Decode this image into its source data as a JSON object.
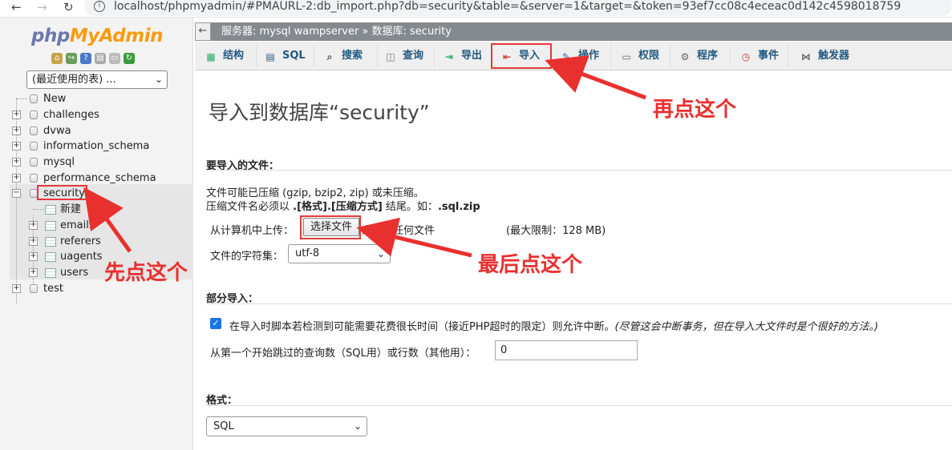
{
  "browser": {
    "url": "localhost/phpmyadmin/#PMAURL-2:db_import.php?db=security&table=&server=1&target=&token=93ef7cc08c4eceac0d142c4598018759"
  },
  "sidebar": {
    "logo_php": "php",
    "logo_myadmin": "MyAdmin",
    "recent_select": "(最近使用的表) ...",
    "tree": [
      {
        "label": "New"
      },
      {
        "label": "challenges"
      },
      {
        "label": "dvwa"
      },
      {
        "label": "information_schema"
      },
      {
        "label": "mysql"
      },
      {
        "label": "performance_schema"
      },
      {
        "label": "security"
      },
      {
        "label": "新建"
      },
      {
        "label": "emails"
      },
      {
        "label": "referers"
      },
      {
        "label": "uagents"
      },
      {
        "label": "users"
      },
      {
        "label": "test"
      }
    ]
  },
  "breadcrumb": {
    "text": "服务器: mysql wampserver » 数据库: security"
  },
  "tabs": [
    {
      "label": "结构",
      "icon": "structure-icon"
    },
    {
      "label": "SQL",
      "icon": "sql-icon"
    },
    {
      "label": "搜索",
      "icon": "search-icon"
    },
    {
      "label": "查询",
      "icon": "query-icon"
    },
    {
      "label": "导出",
      "icon": "export-icon"
    },
    {
      "label": "导入",
      "icon": "import-icon"
    },
    {
      "label": "操作",
      "icon": "operations-icon"
    },
    {
      "label": "权限",
      "icon": "privileges-icon"
    },
    {
      "label": "程序",
      "icon": "routines-icon"
    },
    {
      "label": "事件",
      "icon": "events-icon"
    },
    {
      "label": "触发器",
      "icon": "triggers-icon"
    }
  ],
  "page": {
    "title": "导入到数据库“security”",
    "file_section": "要导入的文件：",
    "file_line1": "文件可能已压缩 (gzip, bzip2, zip) 或未压缩。",
    "file_line2_pre": "压缩文件名必须以 ",
    "file_line2_bold": ".[格式].[压缩方式]",
    "file_line2_mid": " 结尾。如：",
    "file_line2_ex": ".sql.zip",
    "upload_label": "从计算机中上传：",
    "choose_button": "选择文件",
    "no_file": "未选择任何文件",
    "max_limit": "(最大限制：128 MB)",
    "charset_label": "文件的字符集：",
    "charset_value": "utf-8",
    "partial_section": "部分导入：",
    "interrupt_label": "在导入时脚本若检测到可能需要花费很长时间（接近PHP超时的限定）则允许中断。",
    "interrupt_note": "(尽管这会中断事务，但在导入大文件时是个很好的方法。)",
    "skip_label": "从第一个开始跳过的查询数（SQL用）或行数（其他用）：",
    "skip_value": "0",
    "format_section": "格式：",
    "format_value": "SQL"
  },
  "annotations": {
    "first": "先点这个",
    "second": "再点这个",
    "last": "最后点这个",
    "color": "#e8302f"
  }
}
